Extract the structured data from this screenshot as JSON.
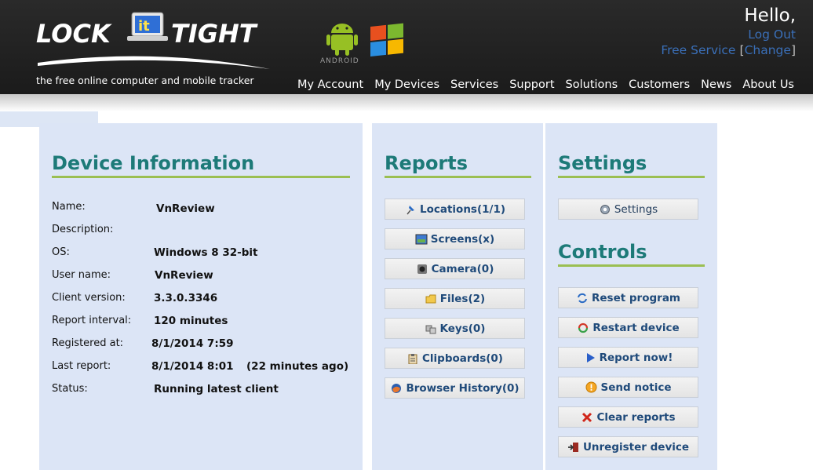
{
  "header": {
    "logo_text_left": "LOCK",
    "logo_text_mid": "it",
    "logo_text_right": "TIGHT",
    "tagline": "the free online computer and mobile tracker",
    "android_label": "ANDROID",
    "hello": "Hello,",
    "logout": "Log Out",
    "service": "Free Service",
    "bracket_open": "[",
    "change": "Change",
    "bracket_close": "]",
    "nav": [
      "My Account",
      "My Devices",
      "Services",
      "Support",
      "Solutions",
      "Customers",
      "News",
      "About Us"
    ]
  },
  "device": {
    "title": "Device Information",
    "rows": [
      {
        "label": "Name:",
        "value": "VnReview"
      },
      {
        "label": "Description:",
        "value": ""
      },
      {
        "label": "OS:",
        "value": "Windows 8 32-bit"
      },
      {
        "label": "User name:",
        "value": "VnReview"
      },
      {
        "label": "Client version:",
        "value": "3.3.0.3346"
      },
      {
        "label": "Report interval:",
        "value": "120 minutes"
      },
      {
        "label": "Registered at:",
        "value": "8/1/2014 7:59"
      },
      {
        "label": "Last report:",
        "value": "8/1/2014 8:01",
        "extra": "(22 minutes ago)"
      },
      {
        "label": "Status:",
        "value": "Running latest client"
      }
    ]
  },
  "reports": {
    "title": "Reports",
    "buttons": [
      {
        "label": "Locations(1/1)",
        "icon": "pin-icon"
      },
      {
        "label": "Screens(x)",
        "icon": "screen-icon"
      },
      {
        "label": "Camera(0)",
        "icon": "camera-icon"
      },
      {
        "label": "Files(2)",
        "icon": "folder-icon"
      },
      {
        "label": "Keys(0)",
        "icon": "keys-icon"
      },
      {
        "label": "Clipboards(0)",
        "icon": "clipboard-icon"
      },
      {
        "label": "Browser History(0)",
        "icon": "browser-icon"
      }
    ]
  },
  "settings": {
    "title": "Settings",
    "button": {
      "label": "Settings",
      "icon": "gear-icon"
    }
  },
  "controls": {
    "title": "Controls",
    "buttons": [
      {
        "label": "Reset program",
        "icon": "reset-icon"
      },
      {
        "label": "Restart device",
        "icon": "restart-icon"
      },
      {
        "label": "Report now!",
        "icon": "play-icon"
      },
      {
        "label": "Send notice",
        "icon": "notice-icon"
      },
      {
        "label": "Clear reports",
        "icon": "close-icon"
      },
      {
        "label": "Unregister device",
        "icon": "unregister-icon"
      }
    ]
  },
  "colors": {
    "header_bg": "#1f1f1f",
    "panel_bg": "#dce5f6",
    "title_color": "#1d7a78",
    "underline": "#9bbf52",
    "link_blue": "#3a6fb8"
  }
}
